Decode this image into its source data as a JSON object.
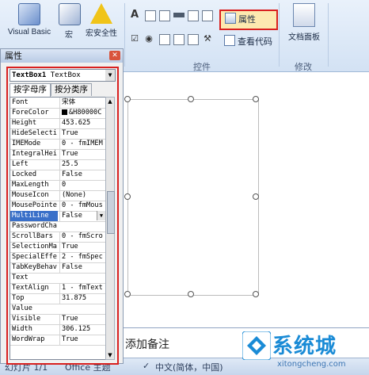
{
  "ribbon": {
    "visual_basic_label": "Visual Basic",
    "macro_label": "宏",
    "macro_security_label": "宏安全性",
    "properties_label": "属性",
    "view_code_label": "查看代码",
    "controls_group_label": "控件",
    "document_panel_label": "文档面板",
    "modify_group_label": "修改"
  },
  "properties_window": {
    "title": "属性",
    "object_name": "TextBox1",
    "object_type": "TextBox",
    "tabs": [
      "按字母序",
      "按分类序"
    ],
    "rows": [
      {
        "name": "Font",
        "value": "宋体"
      },
      {
        "name": "ForeColor",
        "value": "&H80000C"
      },
      {
        "name": "Height",
        "value": "453.625"
      },
      {
        "name": "HideSelecti",
        "value": "True"
      },
      {
        "name": "IMEMode",
        "value": "0 - fmIMEM"
      },
      {
        "name": "IntegralHei",
        "value": "True"
      },
      {
        "name": "Left",
        "value": "25.5"
      },
      {
        "name": "Locked",
        "value": "False"
      },
      {
        "name": "MaxLength",
        "value": "0"
      },
      {
        "name": "MouseIcon",
        "value": "(None)"
      },
      {
        "name": "MousePointe",
        "value": "0 - fmMous"
      },
      {
        "name": "MultiLine",
        "value": "False"
      },
      {
        "name": "PasswordCha",
        "value": ""
      },
      {
        "name": "ScrollBars",
        "value": "0 - fmScro"
      },
      {
        "name": "SelectionMa",
        "value": "True"
      },
      {
        "name": "SpecialEffe",
        "value": "2 - fmSpec"
      },
      {
        "name": "TabKeyBehav",
        "value": "False"
      },
      {
        "name": "Text",
        "value": ""
      },
      {
        "name": "TextAlign",
        "value": "1 - fmText"
      },
      {
        "name": "Top",
        "value": "31.875"
      },
      {
        "name": "Value",
        "value": ""
      },
      {
        "name": "Visible",
        "value": "True"
      },
      {
        "name": "Width",
        "value": "306.125"
      },
      {
        "name": "WordWrap",
        "value": "True"
      }
    ]
  },
  "slide": {
    "notes_placeholder": "添加备注"
  },
  "status_bar": {
    "slide_info": "幻灯片 1/1",
    "theme": "Office 主题",
    "language": "中文(简体，中国)"
  },
  "watermark": {
    "brand": "系统城",
    "url": "xitongcheng.com"
  },
  "colors": {
    "highlight_red": "#d9201f",
    "selection_blue": "#3a70c9",
    "brand_blue": "#1a8bd6"
  }
}
